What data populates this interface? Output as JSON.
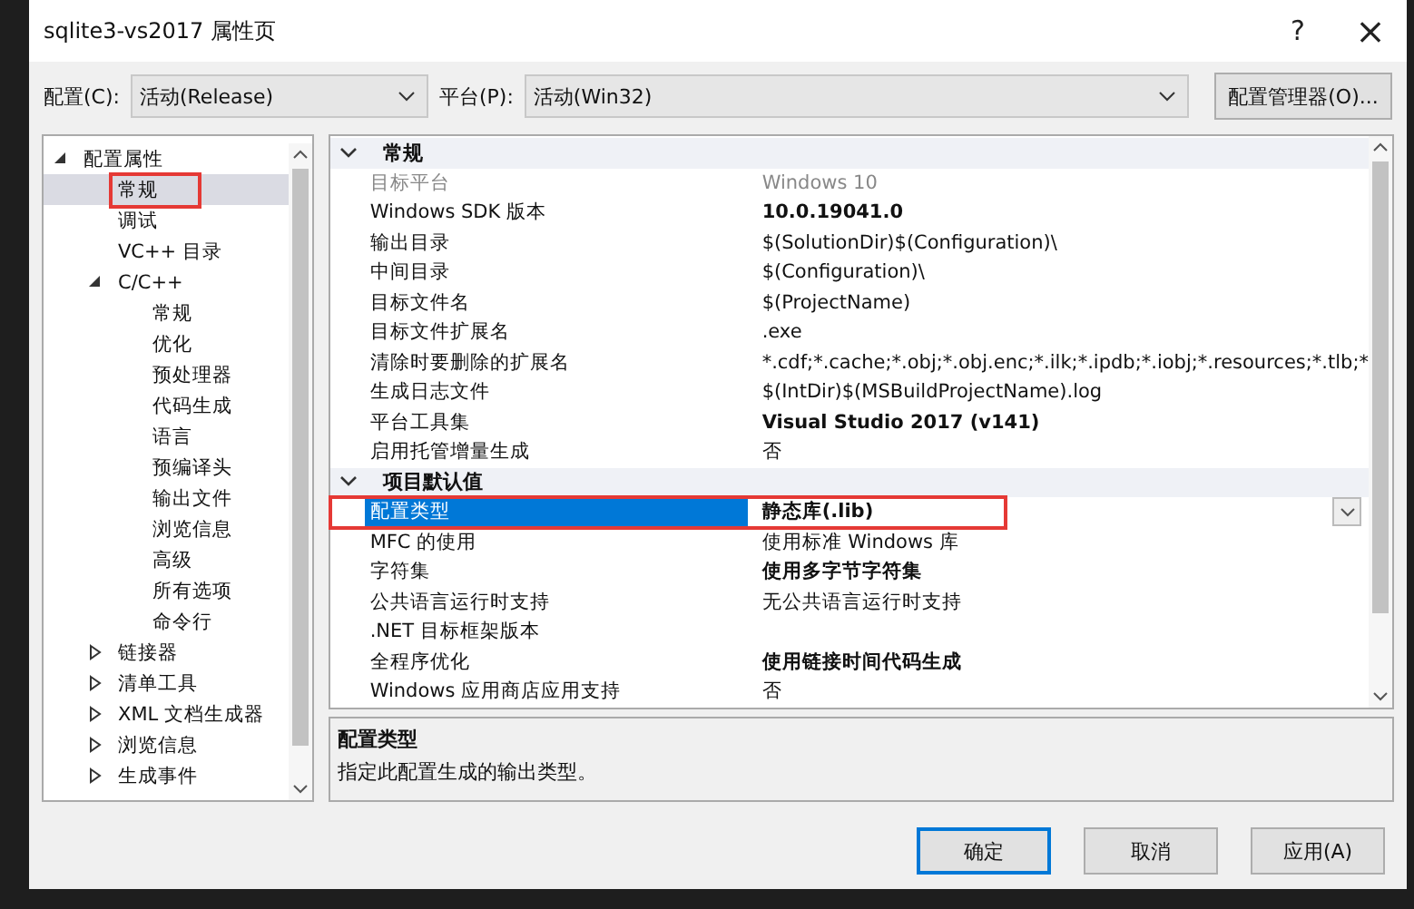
{
  "window": {
    "title": "sqlite3-vs2017 属性页",
    "help": "?",
    "close": "×"
  },
  "config": {
    "label": "配置(C):",
    "value": "活动(Release)"
  },
  "platform": {
    "label": "平台(P):",
    "value": "活动(Win32)"
  },
  "config_manager": "配置管理器(O)...",
  "tree": [
    {
      "label": "配置属性",
      "expanded": true,
      "children": [
        {
          "label": "常规",
          "selected": true,
          "annotated": true
        },
        {
          "label": "调试",
          "selected": false
        },
        {
          "label": "VC++ 目录",
          "selected": false
        },
        {
          "label": "C/C++",
          "selected": false,
          "expanded": true,
          "children": [
            {
              "label": "常规",
              "selected": false
            },
            {
              "label": "优化",
              "selected": false
            },
            {
              "label": "预处理器",
              "selected": false
            },
            {
              "label": "代码生成",
              "selected": false
            },
            {
              "label": "语言",
              "selected": false
            },
            {
              "label": "预编译头",
              "selected": false
            },
            {
              "label": "输出文件",
              "selected": false
            },
            {
              "label": "浏览信息",
              "selected": false
            },
            {
              "label": "高级",
              "selected": false
            },
            {
              "label": "所有选项",
              "selected": false
            },
            {
              "label": "命令行",
              "selected": false
            }
          ]
        },
        {
          "label": "链接器",
          "selected": false,
          "expanded": false
        },
        {
          "label": "清单工具",
          "selected": false,
          "expanded": false
        },
        {
          "label": "XML 文档生成器",
          "selected": false,
          "expanded": false
        },
        {
          "label": "浏览信息",
          "selected": false,
          "expanded": false
        },
        {
          "label": "生成事件",
          "selected": false,
          "expanded": false
        }
      ]
    }
  ],
  "sections": [
    {
      "title": "常规",
      "expanded": true,
      "rows": [
        {
          "name": "目标平台",
          "value": "Windows 10",
          "disabled": true,
          "selected": false
        },
        {
          "name": "Windows SDK 版本",
          "value": "10.0.19041.0",
          "bold": true,
          "selected": false
        },
        {
          "name": "输出目录",
          "value": "$(SolutionDir)$(Configuration)\\",
          "selected": false
        },
        {
          "name": "中间目录",
          "value": "$(Configuration)\\",
          "selected": false
        },
        {
          "name": "目标文件名",
          "value": "$(ProjectName)",
          "selected": false
        },
        {
          "name": "目标文件扩展名",
          "value": ".exe",
          "selected": false
        },
        {
          "name": "清除时要删除的扩展名",
          "value": "*.cdf;*.cache;*.obj;*.obj.enc;*.ilk;*.ipdb;*.iobj;*.resources;*.tlb;*",
          "selected": false
        },
        {
          "name": "生成日志文件",
          "value": "$(IntDir)$(MSBuildProjectName).log",
          "selected": false
        },
        {
          "name": "平台工具集",
          "value": "Visual Studio 2017 (v141)",
          "bold": true,
          "selected": false
        },
        {
          "name": "启用托管增量生成",
          "value": "否",
          "selected": false
        }
      ]
    },
    {
      "title": "项目默认值",
      "expanded": true,
      "rows": [
        {
          "name": "配置类型",
          "value": "静态库(.lib)",
          "bold": true,
          "selected": true,
          "annotated": true
        },
        {
          "name": "MFC 的使用",
          "value": "使用标准 Windows 库",
          "selected": false
        },
        {
          "name": "字符集",
          "value": "使用多字节字符集",
          "bold": true,
          "selected": false
        },
        {
          "name": "公共语言运行时支持",
          "value": "无公共语言运行时支持",
          "selected": false
        },
        {
          "name": ".NET 目标框架版本",
          "selected": false
        },
        {
          "name": "全程序优化",
          "value": "使用链接时间代码生成",
          "bold": true,
          "selected": false
        },
        {
          "name": "Windows 应用商店应用支持",
          "value": "否",
          "selected": false
        }
      ]
    }
  ],
  "description": {
    "title": "配置类型",
    "text": "指定此配置生成的输出类型。"
  },
  "buttons": [
    {
      "label": "确定",
      "default": true
    },
    {
      "label": "取消",
      "default": false
    },
    {
      "label": "应用(A)",
      "default": false
    }
  ]
}
